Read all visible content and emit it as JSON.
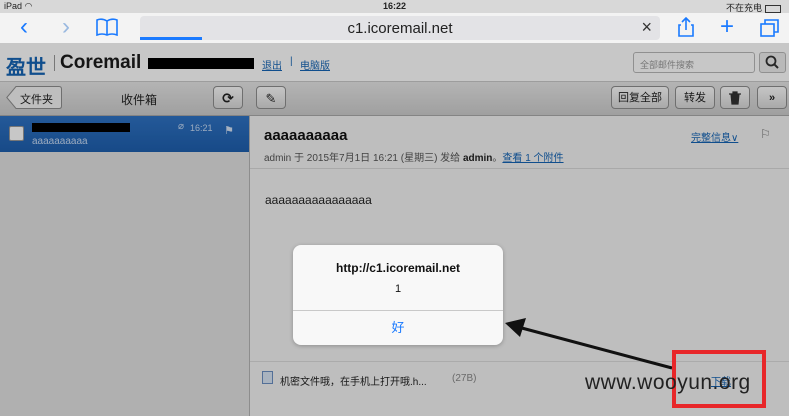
{
  "status_bar": {
    "device": "iPad",
    "wifi_icon": "wifi-icon",
    "time": "16:22",
    "charging": "不在充电"
  },
  "browser": {
    "url": "c1.icoremail.net"
  },
  "header": {
    "logo_cn": "盈世",
    "logo_en": "Coremail",
    "logout_link": "退出",
    "desktop_link": "电脑版",
    "search_placeholder": "全部邮件搜索"
  },
  "toolbar": {
    "folders_button": "文件夹",
    "inbox_title": "收件箱",
    "reply_all_button": "回复全部",
    "forward_button": "转发"
  },
  "message_list": {
    "items": [
      {
        "time": "16:21",
        "preview": "aaaaaaaaaa"
      }
    ]
  },
  "message": {
    "subject": "aaaaaaaaaa",
    "meta_prefix": "admin 于 2015年7月1日 16:21 (星期三) 发给 ",
    "meta_to": "admin",
    "meta_sep": "。",
    "attachment_link": "查看 1 个附件",
    "full_info_link": "完整信息",
    "body": "aaaaaaaaaaaaaaaa",
    "attachment": {
      "name": "机密文件哦，在手机上打开哦.h...",
      "size": "(27B)",
      "download": "下载"
    }
  },
  "alert": {
    "title": "http://c1.icoremail.net",
    "message": "1",
    "ok": "好"
  },
  "watermark": "www.wooyun.org",
  "colors": {
    "accent": "#1a7aff",
    "brand": "#1565b5",
    "highlight": "#e8272a"
  }
}
